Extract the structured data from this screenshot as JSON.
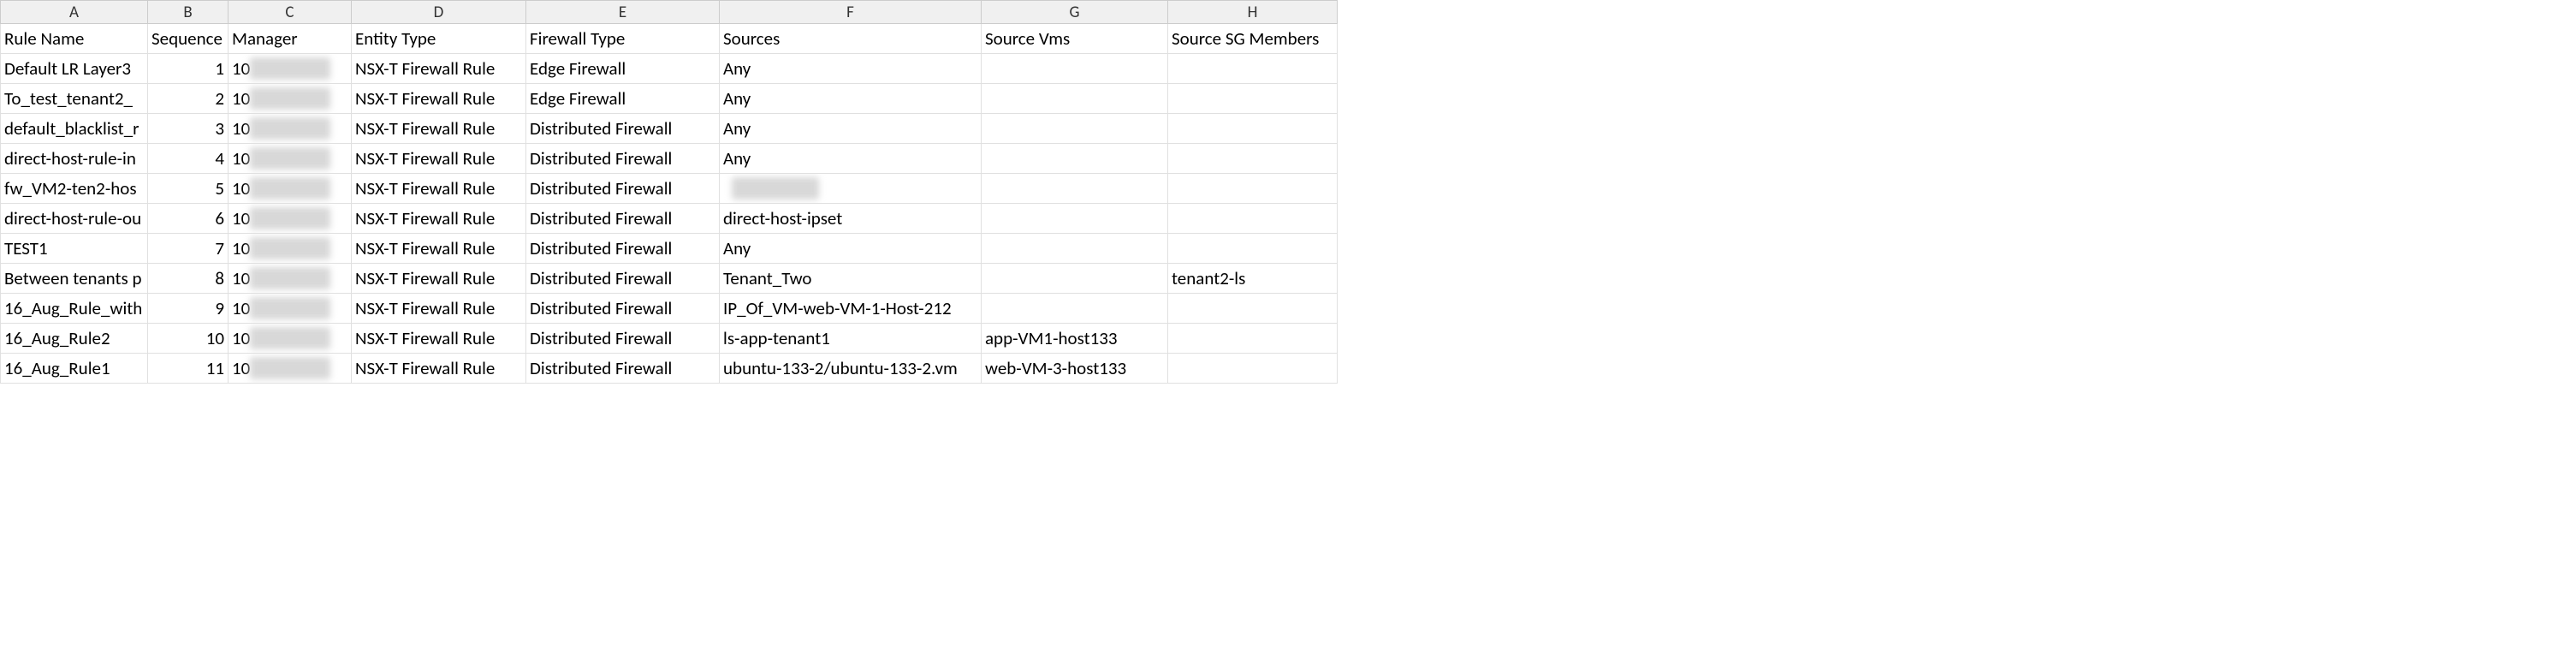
{
  "columns": [
    "A",
    "B",
    "C",
    "D",
    "E",
    "F",
    "G",
    "H"
  ],
  "headers": {
    "A": "Rule Name",
    "B": "Sequence",
    "C": "Manager",
    "D": "Entity Type",
    "E": "Firewall Type",
    "F": "Sources",
    "G": "Source Vms",
    "H": "Source SG Members"
  },
  "manager_visible_prefix": "10",
  "rows": [
    {
      "A": "Default LR Layer3",
      "B": 1,
      "D": "NSX-T Firewall Rule",
      "E": "Edge Firewall",
      "F": "Any",
      "G": "",
      "H": ""
    },
    {
      "A": "To_test_tenant2_",
      "B": 2,
      "D": "NSX-T Firewall Rule",
      "E": "Edge Firewall",
      "F": "Any",
      "G": "",
      "H": ""
    },
    {
      "A": "default_blacklist_r",
      "B": 3,
      "D": "NSX-T Firewall Rule",
      "E": "Distributed Firewall",
      "F": "Any",
      "G": "",
      "H": ""
    },
    {
      "A": "direct-host-rule-in",
      "B": 4,
      "D": "NSX-T Firewall Rule",
      "E": "Distributed Firewall",
      "F": "Any",
      "G": "",
      "H": ""
    },
    {
      "A": "fw_VM2-ten2-hos",
      "B": 5,
      "D": "NSX-T Firewall Rule",
      "E": "Distributed Firewall",
      "F": "__BLUR__",
      "G": "",
      "H": ""
    },
    {
      "A": "direct-host-rule-ou",
      "B": 6,
      "D": "NSX-T Firewall Rule",
      "E": "Distributed Firewall",
      "F": "direct-host-ipset",
      "G": "",
      "H": ""
    },
    {
      "A": "TEST1",
      "B": 7,
      "D": "NSX-T Firewall Rule",
      "E": "Distributed Firewall",
      "F": "Any",
      "G": "",
      "H": ""
    },
    {
      "A": "Between tenants p",
      "B": 8,
      "D": "NSX-T Firewall Rule",
      "E": "Distributed Firewall",
      "F": "Tenant_Two",
      "G": "",
      "H": "tenant2-ls"
    },
    {
      "A": "16_Aug_Rule_with",
      "B": 9,
      "D": "NSX-T Firewall Rule",
      "E": "Distributed Firewall",
      "F": "IP_Of_VM-web-VM-1-Host-212",
      "G": "",
      "H": ""
    },
    {
      "A": "16_Aug_Rule2",
      "B": 10,
      "D": "NSX-T Firewall Rule",
      "E": "Distributed Firewall",
      "F": "ls-app-tenant1",
      "G": "app-VM1-host133",
      "H": ""
    },
    {
      "A": "16_Aug_Rule1",
      "B": 11,
      "D": "NSX-T Firewall Rule",
      "E": "Distributed Firewall",
      "F": "ubuntu-133-2/ubuntu-133-2.vm",
      "G": "web-VM-3-host133",
      "H": ""
    }
  ]
}
